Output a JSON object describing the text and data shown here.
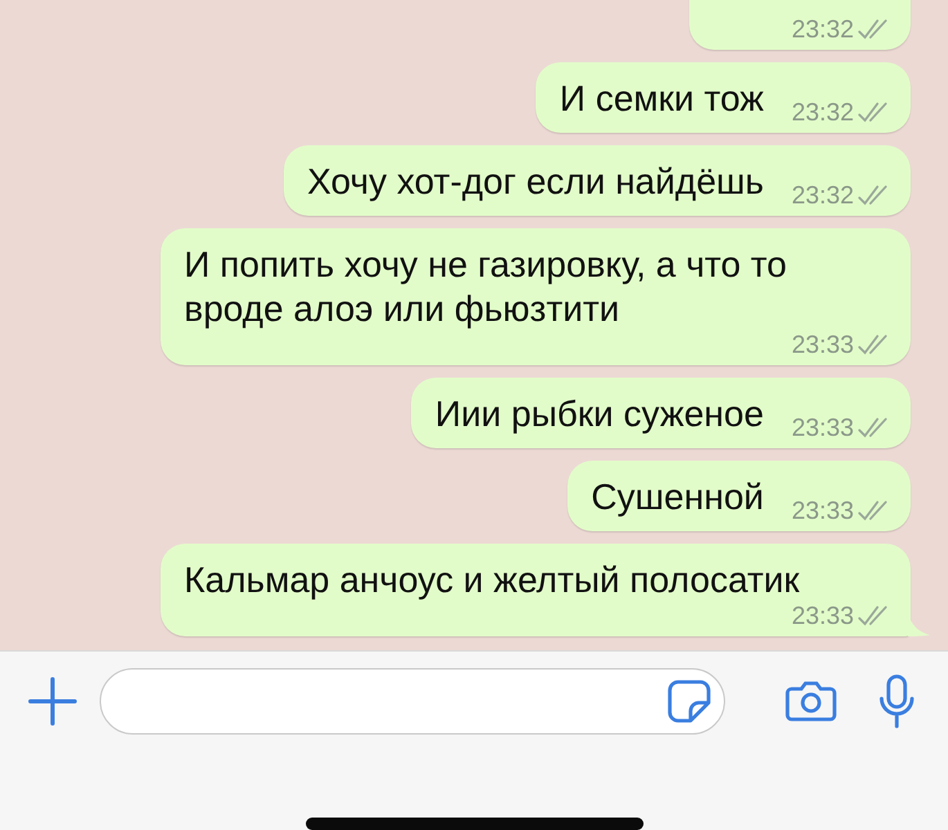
{
  "messages": [
    {
      "time": "23:32"
    },
    {
      "text": "И семки тож",
      "time": "23:32"
    },
    {
      "text": "Хочу хот-дог если найдёшь",
      "time": "23:32"
    },
    {
      "text": "И попить хочу не газировку, а что то вроде алоэ или фьюзтити",
      "time": "23:33"
    },
    {
      "text": "Иии рыбки суженое",
      "time": "23:33"
    },
    {
      "text": "Сушенной",
      "time": "23:33"
    },
    {
      "text": "Кальмар анчоус и желтый полосатик",
      "time": "23:33",
      "tail": true
    }
  ]
}
